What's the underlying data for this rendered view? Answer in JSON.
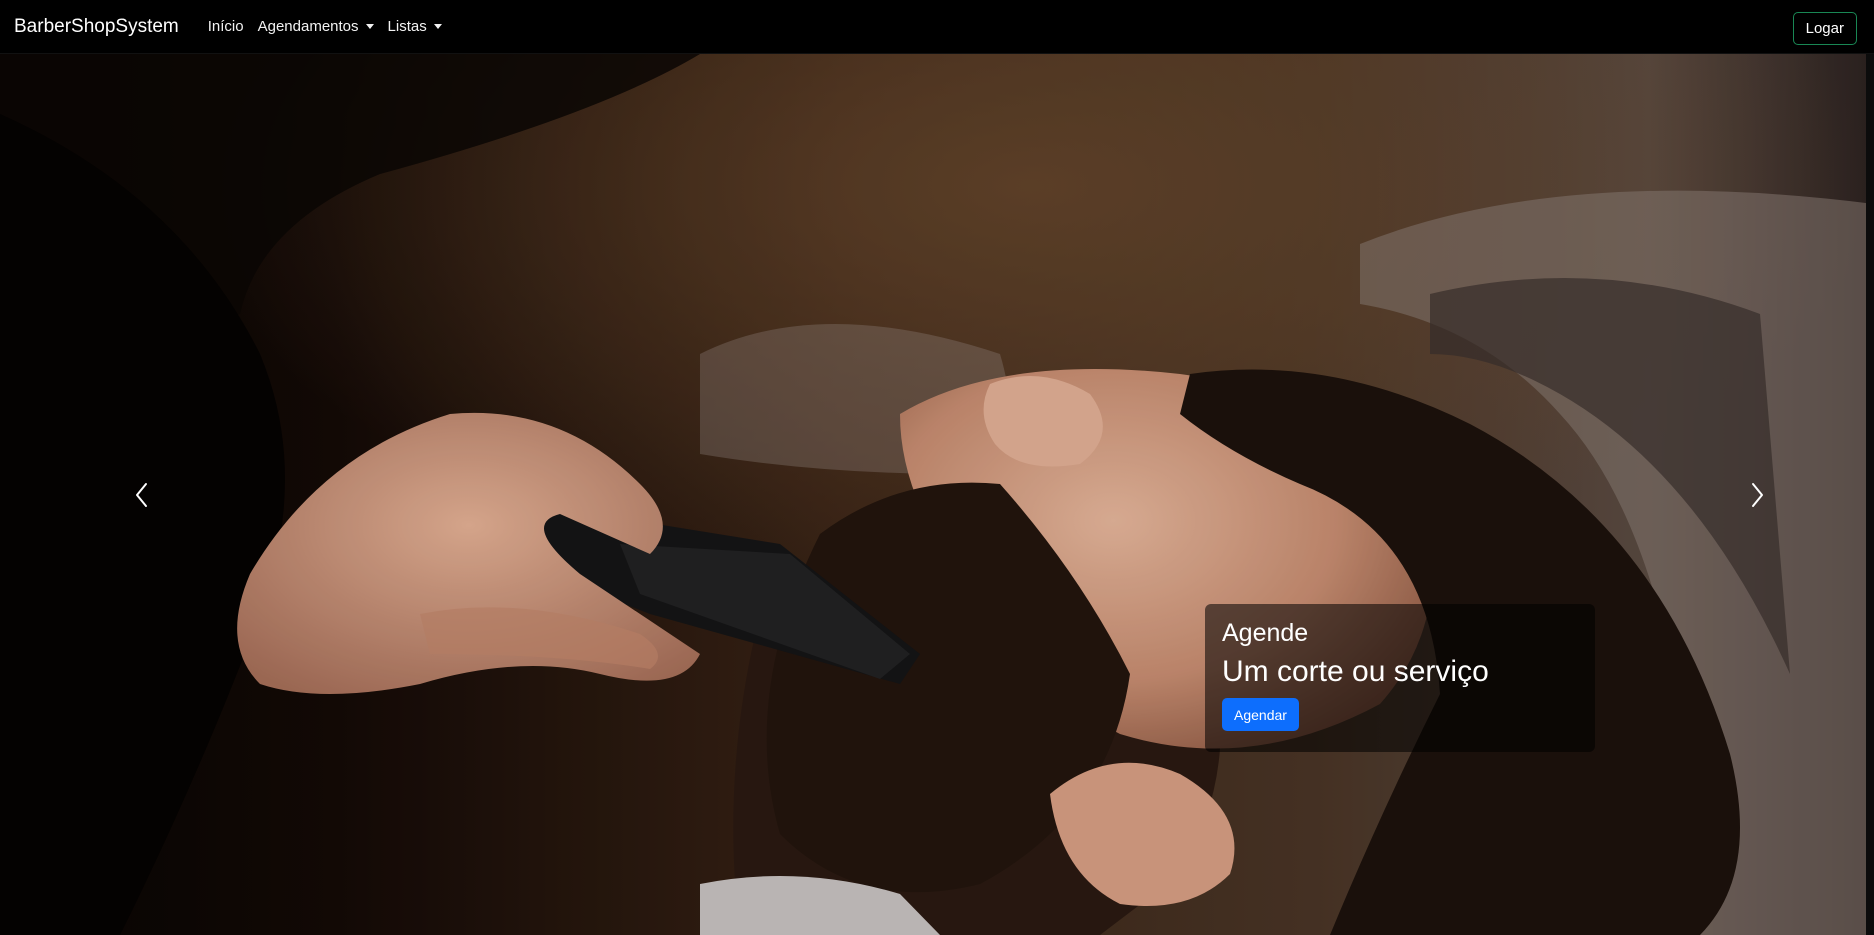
{
  "navbar": {
    "brand": "BarberShopSystem",
    "links": [
      {
        "label": "Início"
      },
      {
        "label": "Agendamentos"
      },
      {
        "label": "Listas"
      }
    ],
    "login_label": "Logar",
    "login_border_color": "#198754"
  },
  "carousel": {
    "prev_icon": "chevron-left-icon",
    "next_icon": "chevron-right-icon",
    "caption": {
      "heading": "Agende",
      "subheading": "Um corte ou serviço",
      "button_label": "Agendar",
      "button_color": "#0d6efd"
    }
  }
}
